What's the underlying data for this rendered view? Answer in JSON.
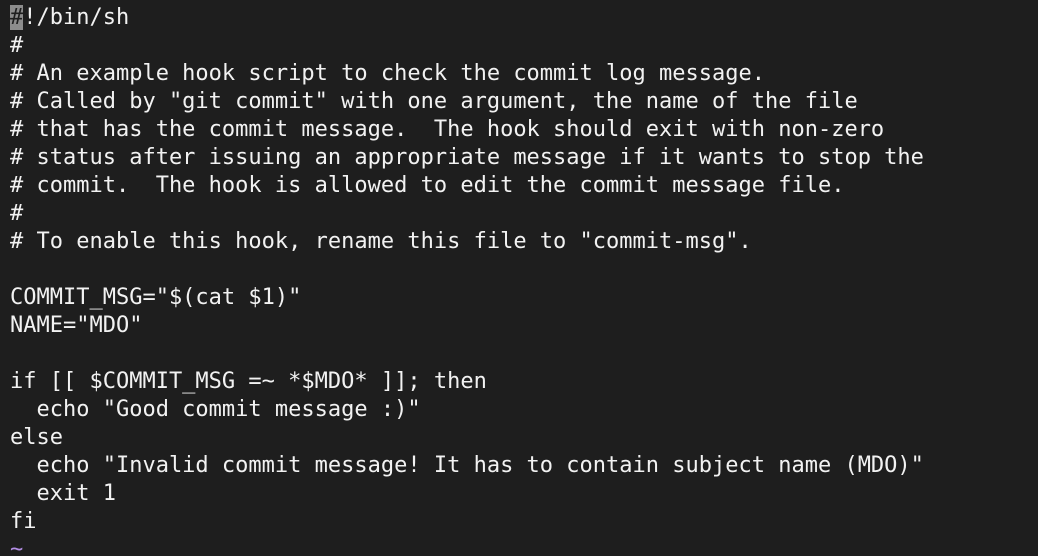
{
  "editor": {
    "cursor_char": "#",
    "first_line_rest": "!/bin/sh",
    "lines": [
      "#",
      "# An example hook script to check the commit log message.",
      "# Called by \"git commit\" with one argument, the name of the file",
      "# that has the commit message.  The hook should exit with non-zero",
      "# status after issuing an appropriate message if it wants to stop the",
      "# commit.  The hook is allowed to edit the commit message file.",
      "#",
      "# To enable this hook, rename this file to \"commit-msg\".",
      "",
      "COMMIT_MSG=\"$(cat $1)\"",
      "NAME=\"MDO\"",
      "",
      "if [[ $COMMIT_MSG =~ *$MDO* ]]; then",
      "  echo \"Good commit message :)\"",
      "else",
      "  echo \"Invalid commit message! It has to contain subject name (MDO)\"",
      "  exit 1",
      "fi"
    ],
    "empty_line_marker": "~"
  },
  "colors": {
    "background": "#1e1e1e",
    "text": "#f2f2f2",
    "cursor": "#8c8c8c",
    "tilde": "#b48ee6"
  }
}
